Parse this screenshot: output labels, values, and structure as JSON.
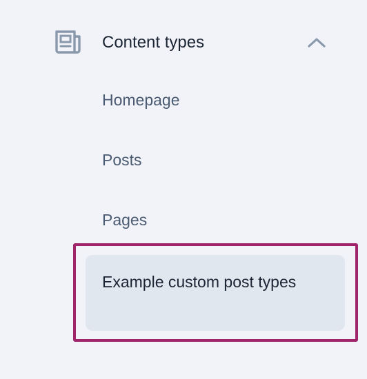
{
  "section": {
    "title": "Content types",
    "icon": "newspaper-icon",
    "toggle_icon": "chevron-up-icon",
    "expanded": true
  },
  "items": [
    {
      "label": "Homepage",
      "active": false
    },
    {
      "label": "Posts",
      "active": false
    },
    {
      "label": "Pages",
      "active": false
    },
    {
      "label": "Example custom post types",
      "active": true
    }
  ],
  "colors": {
    "background": "#f1f3f8",
    "text_primary": "#1c2534",
    "text_secondary": "#4b5b72",
    "icon": "#8a98ab",
    "active_background": "#e1e7ef",
    "highlight_border": "#a0246a"
  }
}
